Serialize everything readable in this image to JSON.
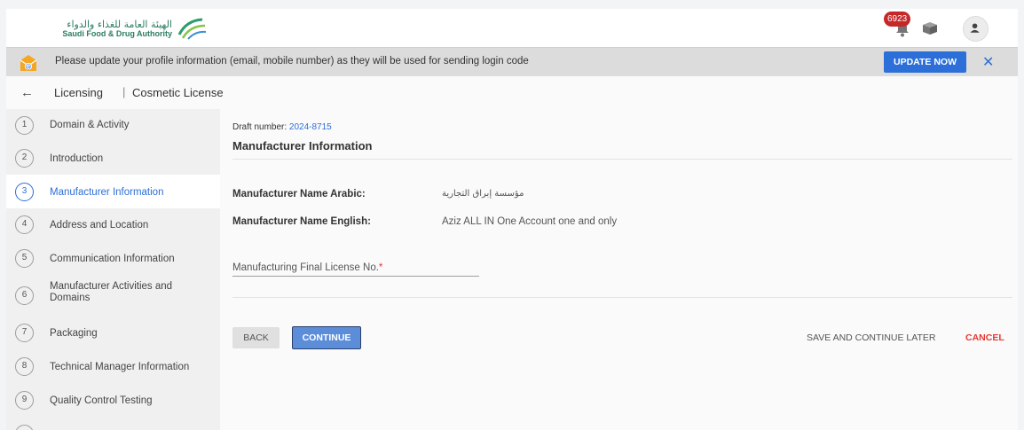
{
  "header": {
    "logo_ar": "الهيئة العامة للغذاء والدواء",
    "logo_en": "Saudi Food & Drug Authority",
    "notification_count": "6923"
  },
  "banner": {
    "message": "Please update your profile information (email, mobile number) as they will be used for sending login code",
    "update_label": "UPDATE NOW",
    "close_glyph": "✕"
  },
  "breadcrumb": {
    "back_glyph": "←",
    "section": "Licensing",
    "separator": "|",
    "page": "Cosmetic License"
  },
  "sidebar": {
    "steps": [
      {
        "num": "1",
        "label": "Domain & Activity"
      },
      {
        "num": "2",
        "label": "Introduction"
      },
      {
        "num": "3",
        "label": "Manufacturer Information"
      },
      {
        "num": "4",
        "label": "Address and Location"
      },
      {
        "num": "5",
        "label": "Communication Information"
      },
      {
        "num": "6",
        "label": "Manufacturer Activities and Domains"
      },
      {
        "num": "7",
        "label": "Packaging"
      },
      {
        "num": "8",
        "label": "Technical Manager Information"
      },
      {
        "num": "9",
        "label": "Quality Control Testing"
      }
    ]
  },
  "main": {
    "draft_label": "Draft number:",
    "draft_number": "2024-8715",
    "title": "Manufacturer Information",
    "fields": [
      {
        "label": "Manufacturer Name Arabic:",
        "value": "مؤسسة إبراق التجارية"
      },
      {
        "label": "Manufacturer Name English:",
        "value": "Aziz ALL IN One Account one and only"
      }
    ],
    "license_label": "Manufacturing Final License No.",
    "required_mark": "*",
    "back_label": "BACK",
    "continue_label": "CONTINUE",
    "save_later_label": "SAVE AND CONTINUE LATER",
    "cancel_label": "CANCEL"
  },
  "colors": {
    "accent": "#2d6fd8",
    "badge": "#c62828",
    "cancel": "#e53935",
    "banner_bg": "#dcdcdc",
    "sidebar_bg": "#f0f0f0"
  },
  "icons": [
    "sfda-logo-icon",
    "bell-icon",
    "box-icon",
    "user-icon",
    "email-notice-icon",
    "close-icon",
    "back-arrow-icon"
  ]
}
